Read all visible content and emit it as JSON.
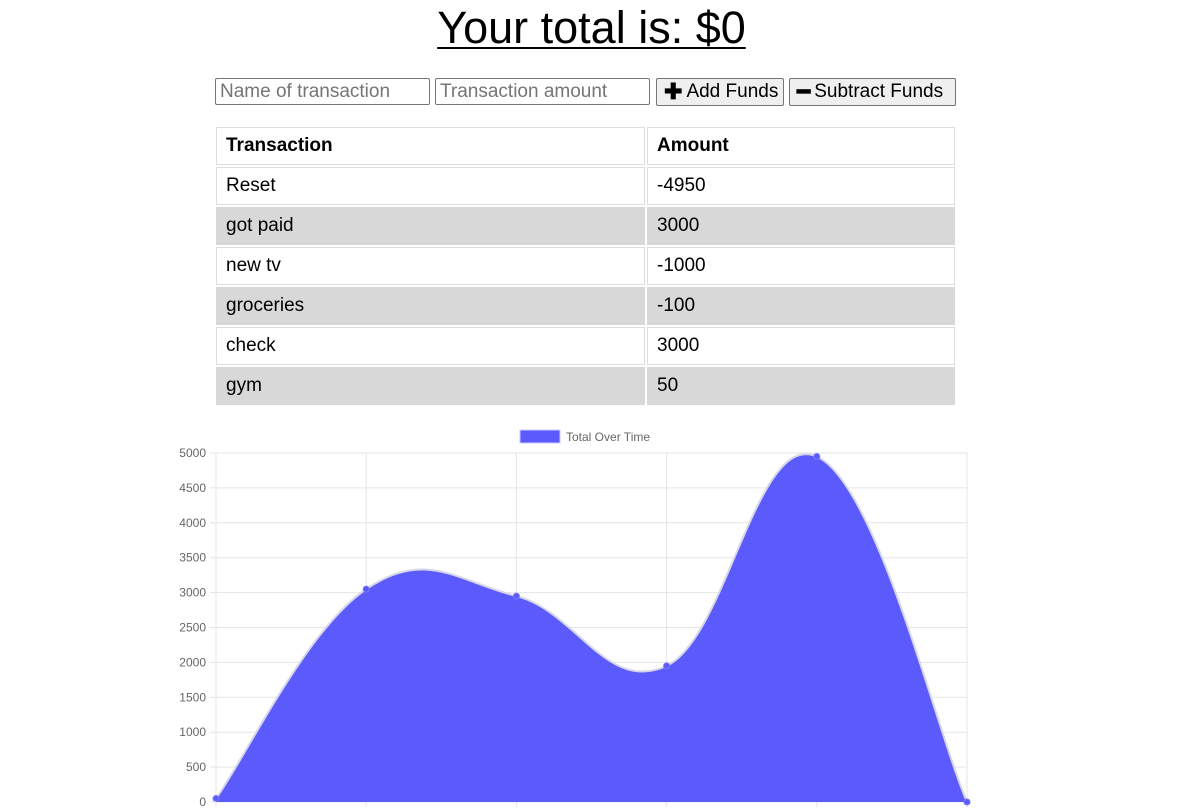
{
  "header": {
    "title": "Your total is: $0"
  },
  "form": {
    "name_placeholder": "Name of transaction",
    "amount_placeholder": "Transaction amount",
    "add_label": "Add Funds",
    "subtract_label": "Subtract Funds",
    "add_icon": "plus-icon",
    "subtract_icon": "minus-icon"
  },
  "table": {
    "headers": [
      "Transaction",
      "Amount"
    ],
    "rows": [
      {
        "name": "Reset",
        "amount": "-4950"
      },
      {
        "name": "got paid",
        "amount": "3000"
      },
      {
        "name": "new tv",
        "amount": "-1000"
      },
      {
        "name": "groceries",
        "amount": "-100"
      },
      {
        "name": "check",
        "amount": "3000"
      },
      {
        "name": "gym",
        "amount": "50"
      }
    ]
  },
  "chart_data": {
    "type": "area",
    "x": [
      "",
      "",
      "",
      "",
      "",
      ""
    ],
    "series": [
      {
        "name": "Total Over Time",
        "values": [
          50,
          3050,
          2950,
          1950,
          4950,
          0
        ],
        "color": "#5b5bfd"
      }
    ],
    "ylim": [
      0,
      5000
    ],
    "yticks": [
      0,
      500,
      1000,
      1500,
      2000,
      2500,
      3000,
      3500,
      4000,
      4500,
      5000
    ],
    "legend": "top-center",
    "grid": true
  }
}
